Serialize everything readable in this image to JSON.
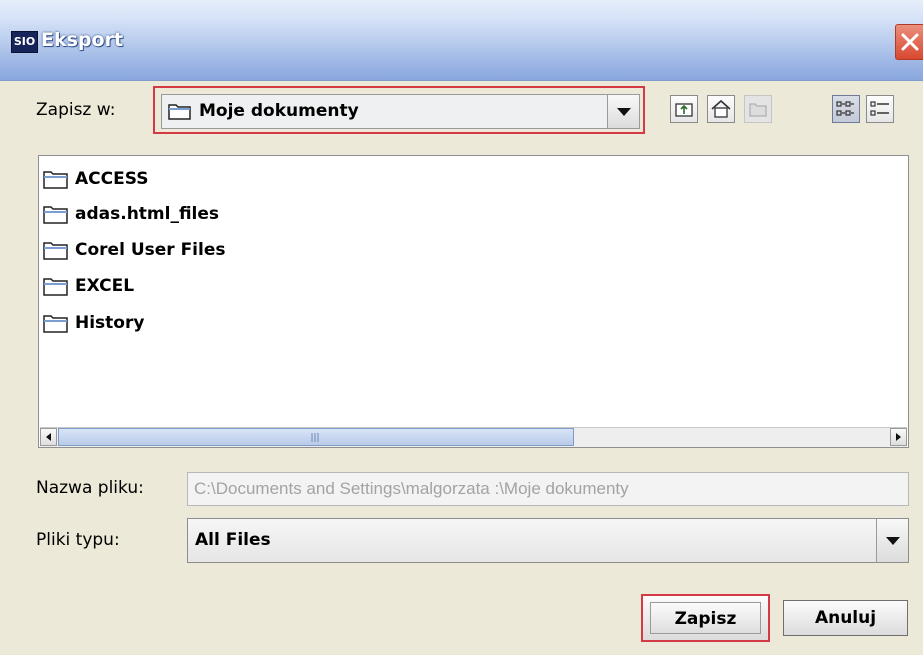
{
  "window": {
    "app_icon_text": "SIO",
    "title": "Eksport",
    "close_icon": "close-icon"
  },
  "toolbar": {
    "look_in_label": "Zapisz w:",
    "look_in_value": "Moje dokumenty",
    "buttons": [
      "up-folder-icon",
      "home-icon",
      "new-folder-icon",
      "list-view-icon",
      "details-view-icon"
    ]
  },
  "files": [
    {
      "name": "ACCESS",
      "icon": "folder-icon"
    },
    {
      "name": "adas.html_files",
      "icon": "folder-icon"
    },
    {
      "name": "Corel User Files",
      "icon": "folder-icon"
    },
    {
      "name": "EXCEL",
      "icon": "folder-icon"
    },
    {
      "name": "History",
      "icon": "folder-icon"
    }
  ],
  "form": {
    "file_name_label": "Nazwa pliku:",
    "file_name_value": "C:\\Documents and Settings\\malgorzata          :\\Moje dokumenty",
    "file_type_label": "Pliki typu:",
    "file_type_value": "All Files"
  },
  "actions": {
    "save": "Zapisz",
    "cancel": "Anuluj"
  },
  "colors": {
    "highlight_border": "#d43a45",
    "title_gradient_end": "#8aa8de",
    "dialog_bg": "#ece9d8"
  }
}
